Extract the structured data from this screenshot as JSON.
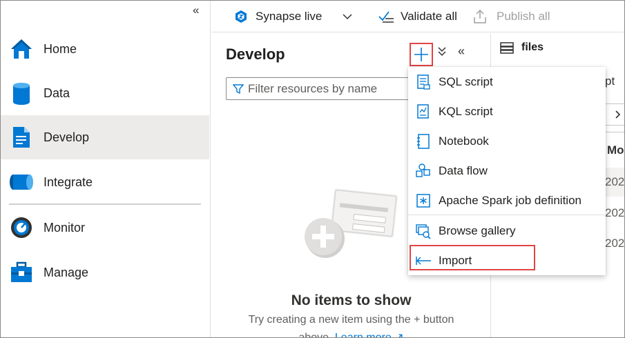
{
  "left_nav": {
    "collapse_icon": "double-chevron-left-icon",
    "items": [
      {
        "label": "Home",
        "icon": "home-icon",
        "selected": false
      },
      {
        "label": "Data",
        "icon": "database-icon",
        "selected": false
      },
      {
        "label": "Develop",
        "icon": "document-icon",
        "selected": true
      },
      {
        "label": "Integrate",
        "icon": "pipeline-icon",
        "selected": false
      },
      {
        "label": "Monitor",
        "icon": "gauge-icon",
        "selected": false
      },
      {
        "label": "Manage",
        "icon": "toolbox-icon",
        "selected": false
      }
    ]
  },
  "toolbar": {
    "workspace_label": "Synapse live",
    "validate_label": "Validate all",
    "publish_label": "Publish all"
  },
  "develop": {
    "title": "Develop",
    "filter_placeholder": "Filter resources by name",
    "empty_title": "No items to show",
    "empty_subtitle": "Try creating a new item using the + button",
    "empty_subtitle_tail": "above.",
    "learn_more": "Learn more"
  },
  "right_pane": {
    "files_label": "files",
    "partial_text": "pt",
    "column_header_partial": "Mo",
    "row_values": [
      "202",
      "202",
      "202"
    ]
  },
  "new_menu": {
    "items": [
      {
        "label": "SQL script",
        "icon": "sql-script-icon"
      },
      {
        "label": "KQL script",
        "icon": "kql-script-icon"
      },
      {
        "label": "Notebook",
        "icon": "notebook-icon"
      },
      {
        "label": "Data flow",
        "icon": "data-flow-icon"
      },
      {
        "label": "Apache Spark job definition",
        "icon": "spark-job-icon"
      },
      {
        "label": "Browse gallery",
        "icon": "browse-gallery-icon"
      },
      {
        "label": "Import",
        "icon": "import-icon"
      }
    ]
  },
  "colors": {
    "accent": "#0078d4",
    "highlight_border": "#e04343",
    "selected_nav_bg": "#edebe9"
  }
}
